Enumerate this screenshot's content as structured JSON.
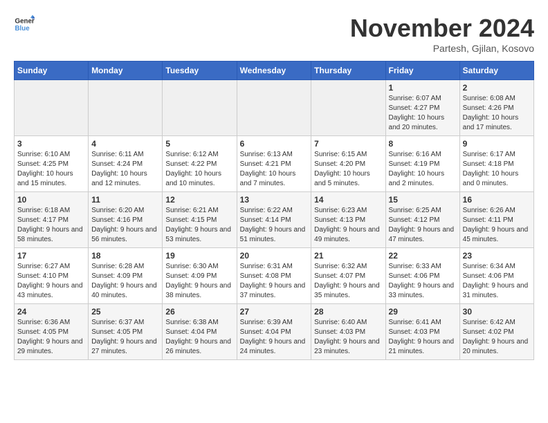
{
  "header": {
    "logo_line1": "General",
    "logo_line2": "Blue",
    "month": "November 2024",
    "location": "Partesh, Gjilan, Kosovo"
  },
  "weekdays": [
    "Sunday",
    "Monday",
    "Tuesday",
    "Wednesday",
    "Thursday",
    "Friday",
    "Saturday"
  ],
  "weeks": [
    [
      {
        "day": "",
        "info": ""
      },
      {
        "day": "",
        "info": ""
      },
      {
        "day": "",
        "info": ""
      },
      {
        "day": "",
        "info": ""
      },
      {
        "day": "",
        "info": ""
      },
      {
        "day": "1",
        "info": "Sunrise: 6:07 AM\nSunset: 4:27 PM\nDaylight: 10 hours and 20 minutes."
      },
      {
        "day": "2",
        "info": "Sunrise: 6:08 AM\nSunset: 4:26 PM\nDaylight: 10 hours and 17 minutes."
      }
    ],
    [
      {
        "day": "3",
        "info": "Sunrise: 6:10 AM\nSunset: 4:25 PM\nDaylight: 10 hours and 15 minutes."
      },
      {
        "day": "4",
        "info": "Sunrise: 6:11 AM\nSunset: 4:24 PM\nDaylight: 10 hours and 12 minutes."
      },
      {
        "day": "5",
        "info": "Sunrise: 6:12 AM\nSunset: 4:22 PM\nDaylight: 10 hours and 10 minutes."
      },
      {
        "day": "6",
        "info": "Sunrise: 6:13 AM\nSunset: 4:21 PM\nDaylight: 10 hours and 7 minutes."
      },
      {
        "day": "7",
        "info": "Sunrise: 6:15 AM\nSunset: 4:20 PM\nDaylight: 10 hours and 5 minutes."
      },
      {
        "day": "8",
        "info": "Sunrise: 6:16 AM\nSunset: 4:19 PM\nDaylight: 10 hours and 2 minutes."
      },
      {
        "day": "9",
        "info": "Sunrise: 6:17 AM\nSunset: 4:18 PM\nDaylight: 10 hours and 0 minutes."
      }
    ],
    [
      {
        "day": "10",
        "info": "Sunrise: 6:18 AM\nSunset: 4:17 PM\nDaylight: 9 hours and 58 minutes."
      },
      {
        "day": "11",
        "info": "Sunrise: 6:20 AM\nSunset: 4:16 PM\nDaylight: 9 hours and 56 minutes."
      },
      {
        "day": "12",
        "info": "Sunrise: 6:21 AM\nSunset: 4:15 PM\nDaylight: 9 hours and 53 minutes."
      },
      {
        "day": "13",
        "info": "Sunrise: 6:22 AM\nSunset: 4:14 PM\nDaylight: 9 hours and 51 minutes."
      },
      {
        "day": "14",
        "info": "Sunrise: 6:23 AM\nSunset: 4:13 PM\nDaylight: 9 hours and 49 minutes."
      },
      {
        "day": "15",
        "info": "Sunrise: 6:25 AM\nSunset: 4:12 PM\nDaylight: 9 hours and 47 minutes."
      },
      {
        "day": "16",
        "info": "Sunrise: 6:26 AM\nSunset: 4:11 PM\nDaylight: 9 hours and 45 minutes."
      }
    ],
    [
      {
        "day": "17",
        "info": "Sunrise: 6:27 AM\nSunset: 4:10 PM\nDaylight: 9 hours and 43 minutes."
      },
      {
        "day": "18",
        "info": "Sunrise: 6:28 AM\nSunset: 4:09 PM\nDaylight: 9 hours and 40 minutes."
      },
      {
        "day": "19",
        "info": "Sunrise: 6:30 AM\nSunset: 4:09 PM\nDaylight: 9 hours and 38 minutes."
      },
      {
        "day": "20",
        "info": "Sunrise: 6:31 AM\nSunset: 4:08 PM\nDaylight: 9 hours and 37 minutes."
      },
      {
        "day": "21",
        "info": "Sunrise: 6:32 AM\nSunset: 4:07 PM\nDaylight: 9 hours and 35 minutes."
      },
      {
        "day": "22",
        "info": "Sunrise: 6:33 AM\nSunset: 4:06 PM\nDaylight: 9 hours and 33 minutes."
      },
      {
        "day": "23",
        "info": "Sunrise: 6:34 AM\nSunset: 4:06 PM\nDaylight: 9 hours and 31 minutes."
      }
    ],
    [
      {
        "day": "24",
        "info": "Sunrise: 6:36 AM\nSunset: 4:05 PM\nDaylight: 9 hours and 29 minutes."
      },
      {
        "day": "25",
        "info": "Sunrise: 6:37 AM\nSunset: 4:05 PM\nDaylight: 9 hours and 27 minutes."
      },
      {
        "day": "26",
        "info": "Sunrise: 6:38 AM\nSunset: 4:04 PM\nDaylight: 9 hours and 26 minutes."
      },
      {
        "day": "27",
        "info": "Sunrise: 6:39 AM\nSunset: 4:04 PM\nDaylight: 9 hours and 24 minutes."
      },
      {
        "day": "28",
        "info": "Sunrise: 6:40 AM\nSunset: 4:03 PM\nDaylight: 9 hours and 23 minutes."
      },
      {
        "day": "29",
        "info": "Sunrise: 6:41 AM\nSunset: 4:03 PM\nDaylight: 9 hours and 21 minutes."
      },
      {
        "day": "30",
        "info": "Sunrise: 6:42 AM\nSunset: 4:02 PM\nDaylight: 9 hours and 20 minutes."
      }
    ]
  ]
}
